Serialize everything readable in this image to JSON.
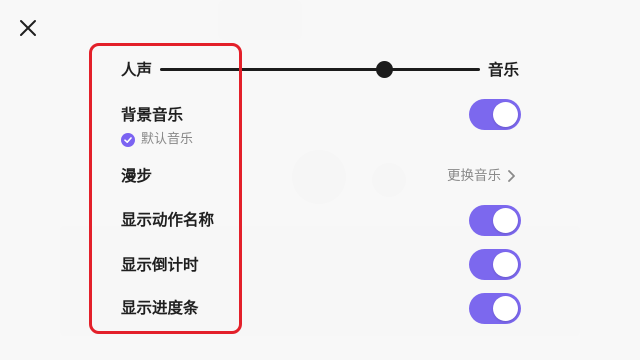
{
  "volume_mix": {
    "left_label": "人声",
    "right_label": "音乐",
    "level": 0.7
  },
  "background_music": {
    "label": "背景音乐",
    "enabled": true,
    "selected_music": "默认音乐"
  },
  "stroll": {
    "label": "漫步",
    "action_label": "更换音乐"
  },
  "show_action_name": {
    "label": "显示动作名称",
    "enabled": true
  },
  "show_countdown": {
    "label": "显示倒计时",
    "enabled": true
  },
  "show_progress_bar": {
    "label": "显示进度条",
    "enabled": true
  },
  "colors": {
    "accent": "#7c68ee",
    "highlight": "#e3202a",
    "text": "#1f1f1f"
  },
  "icons": {
    "close": "close-icon",
    "check": "check-circle-icon",
    "chevron": "chevron-right-icon"
  }
}
